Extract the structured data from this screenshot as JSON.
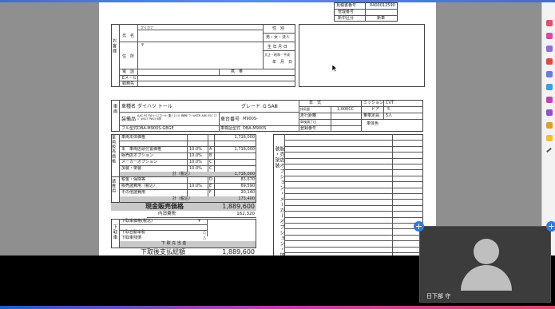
{
  "header": {
    "rows": [
      {
        "label": "見積書番号",
        "value": "0400012590"
      },
      {
        "label": "管理番号",
        "value": ""
      },
      {
        "label": "新中区分",
        "value": "新車"
      }
    ]
  },
  "customer": {
    "section": "お客様",
    "name_label": "氏　名",
    "kana": "フリガナ",
    "gender_label": "性　別",
    "gender_value": "男・女・法人",
    "address_label": "住　所",
    "postal_mark": "〒",
    "dob_label": "生 年 月 日",
    "era": "大正・昭和・平成",
    "ymd": "年　月　日",
    "phone_label": "電　話",
    "mobile_label": "携　帯",
    "email_label": "Eメール",
    "work_label": "勤務先"
  },
  "vehicle": {
    "section": "車両",
    "model_label": "車種名",
    "model_value": "ダイハツ トール",
    "grade_label": "グレード",
    "grade_value": "G SAⅢ",
    "equip_label": "装備品",
    "equip_value": "AAC PS PW ｷｰﾚｽ ｽﾏｰﾄｷｰ 集ﾄﾞﾛ ﾗｲﾄ 両側ﾊﾟﾜｰ WSTR ABS ESC ｴｱﾊﾞ WSｴｱ PWｽﾗ 6際",
    "chassis_label": "車台番号",
    "chassis_value": "M900S-",
    "fullmodel_label": "フル型式",
    "fullmodel_value": "DBA-M900S-GBGE",
    "cert_label": "車検証型式",
    "cert_value": "DBA-M900S",
    "type_label": "年　式",
    "disp_label": "排気量",
    "disp_value": "1,000CC",
    "mission_label": "ミッション",
    "mission_value": "CVT",
    "door_label": "ドア",
    "door_value": "5",
    "mileage_label": "走行距離",
    "capacity_label": "乗車定員",
    "capacity_value": "5人",
    "inspect_label": "車検満了日",
    "color_label": "車体色",
    "regno_label": "登録番号"
  },
  "price": {
    "section": "車両販売価格",
    "rows": [
      {
        "label": "車両本体価格",
        "value": "1,716,000",
        "pct": "",
        "code": ""
      },
      {
        "label": "",
        "value": "",
        "pct": "",
        "code": ""
      },
      {
        "label": "本　車両店頭付置価格",
        "value": "1,716,000",
        "pct": "10.0%",
        "code": "A"
      },
      {
        "label": "販売店オプション",
        "value": "",
        "pct": "10.0%",
        "code": "B"
      },
      {
        "label": "メーカーオプション",
        "value": "",
        "pct": "10.0%",
        "code": "C"
      },
      {
        "label": "加装・架装",
        "value": "",
        "pct": "10.0%",
        "code": "C"
      }
    ],
    "subtotal_label": "計（税込）",
    "subtotal_value": "1,716,000"
  },
  "fees": {
    "section": "諸費用",
    "rows": [
      {
        "label": "税金・保険等",
        "code": "D",
        "value": "83,670",
        "pct": ""
      },
      {
        "label": "販売諸費用（税込）",
        "code": "E",
        "value": "69,590",
        "pct": "10.0%"
      },
      {
        "label": "その他諸費用",
        "code": "F",
        "value": "20,140",
        "pct": ""
      }
    ],
    "total_label": "計（税込）",
    "total_value": "173,400"
  },
  "sale": {
    "label": "現金販売価格",
    "value": "1,889,600",
    "tax_label": "内消費税",
    "tax_value": "162,320"
  },
  "tradein": {
    "section": "下取車",
    "price_label": "下取車価格(税込)",
    "price_mark": "¥",
    "car_label": "下取自動車税",
    "car_mark": "△",
    "rebate_label": "下取車残債",
    "rebate_mark": "△",
    "net_label": "下 取 充 当 金",
    "final_label": "下取後支払総額",
    "final_value": "1,889,600"
  },
  "options_panel": {
    "title": "販売店オプション・メーカーオプション・加装・架装"
  },
  "video": {
    "name": "日下部 守"
  }
}
